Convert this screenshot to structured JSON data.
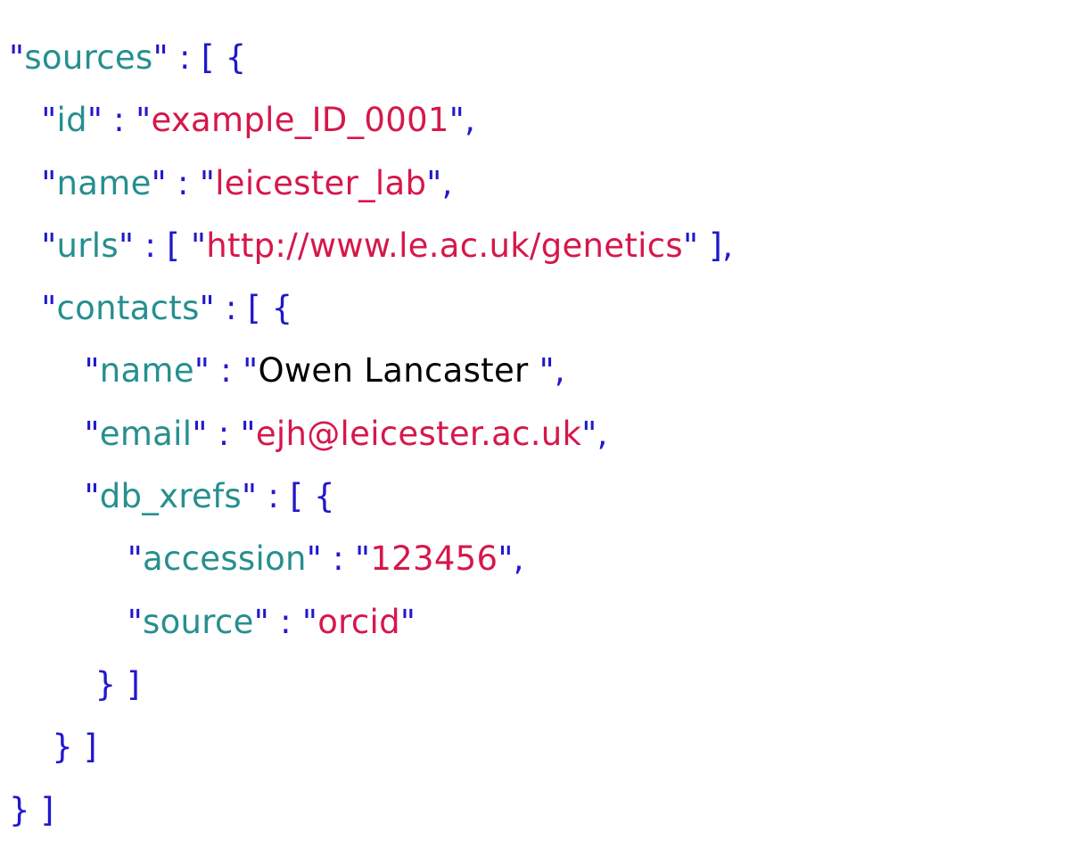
{
  "syntax": {
    "q": "\"",
    "colon_space": " : ",
    "comma": ",",
    "lbracket": "[",
    "rbracket": "]",
    "lbrace": "{",
    "rbrace": "}",
    "lbracket_sp": "[ ",
    "rbracket_sp": " ]",
    "lbrace_sp": "{ ",
    "rbrace_sp": " }",
    "arr_obj_open": "[ {",
    "obj_arr_close": "} ]"
  },
  "lines": {
    "l1": {
      "key": "sources"
    },
    "l2": {
      "key": "id",
      "val": "example_ID_0001"
    },
    "l3": {
      "key": "name",
      "val": "leicester_lab"
    },
    "l4": {
      "key": "urls",
      "val": "http://www.le.ac.uk/genetics"
    },
    "l5": {
      "key": "contacts"
    },
    "l6": {
      "key": "name",
      "val": "Owen Lancaster "
    },
    "l7": {
      "key": "email",
      "val": "ejh@leicester.ac.uk"
    },
    "l8": {
      "key": "db_xrefs"
    },
    "l9": {
      "key": "accession",
      "val": "123456"
    },
    "l10": {
      "key": "source",
      "val": "orcid"
    }
  }
}
